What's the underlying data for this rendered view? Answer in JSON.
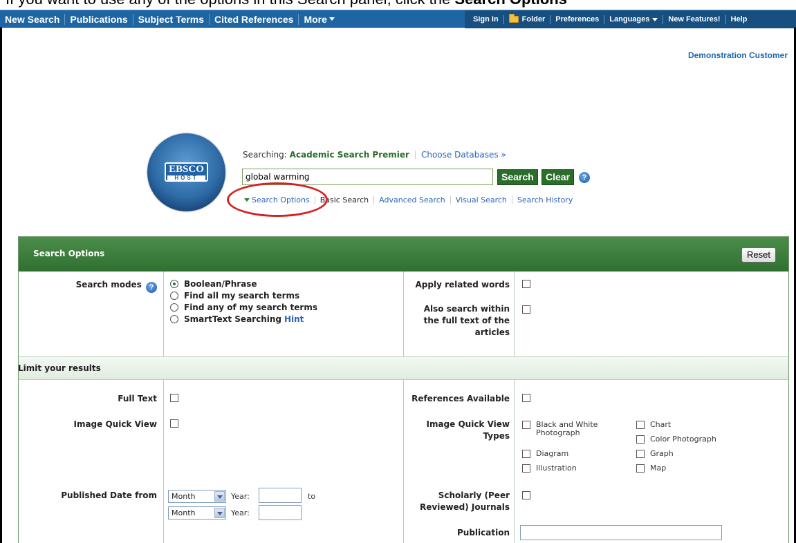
{
  "doc_line": {
    "prefix": "If you want to use any of the options in this Search panel, click the ",
    "bold": "Search Options"
  },
  "topnav": {
    "left": [
      "New Search",
      "Publications",
      "Subject Terms",
      "Cited References",
      "More"
    ],
    "right": {
      "sign_in": "Sign In",
      "folder": "Folder",
      "preferences": "Preferences",
      "languages": "Languages",
      "new_features": "New Features!",
      "help": "Help"
    }
  },
  "customer": "Demonstration Customer",
  "logo": {
    "line1": "EBSCO",
    "line2": "HOST"
  },
  "searching": {
    "label": "Searching:",
    "db": "Academic Search Premier",
    "choose": "Choose Databases »"
  },
  "search": {
    "value": "global warming",
    "search_label": "Search",
    "clear_label": "Clear"
  },
  "links": {
    "options": "Search Options",
    "basic": "Basic Search",
    "advanced": "Advanced Search",
    "visual": "Visual Search",
    "history": "Search History"
  },
  "panel": {
    "title": "Search Options",
    "reset": "Reset",
    "search_modes_label": "Search modes",
    "modes": [
      {
        "label": "Boolean/Phrase",
        "selected": true
      },
      {
        "label": "Find all my search terms",
        "selected": false
      },
      {
        "label": "Find any of my search terms",
        "selected": false
      },
      {
        "label": "SmartText Searching",
        "selected": false
      }
    ],
    "hint": "Hint",
    "apply_related": "Apply related words",
    "also_search": "Also search within the full text of the articles",
    "limit_title": "Limit your results",
    "full_text": "Full Text",
    "image_quick_view": "Image Quick View",
    "published_date_from": "Published Date from",
    "references_available": "References Available",
    "iq_types": "Image Quick View Types",
    "iq_options": {
      "bw": "Black and White Photograph",
      "chart": "Chart",
      "color": "Color Photograph",
      "diagram": "Diagram",
      "graph": "Graph",
      "illustration": "Illustration",
      "map": "Map"
    },
    "month": "Month",
    "year_label": "Year:",
    "to": "to",
    "scholarly": "Scholarly (Peer Reviewed) Journals",
    "publication": "Publication"
  }
}
